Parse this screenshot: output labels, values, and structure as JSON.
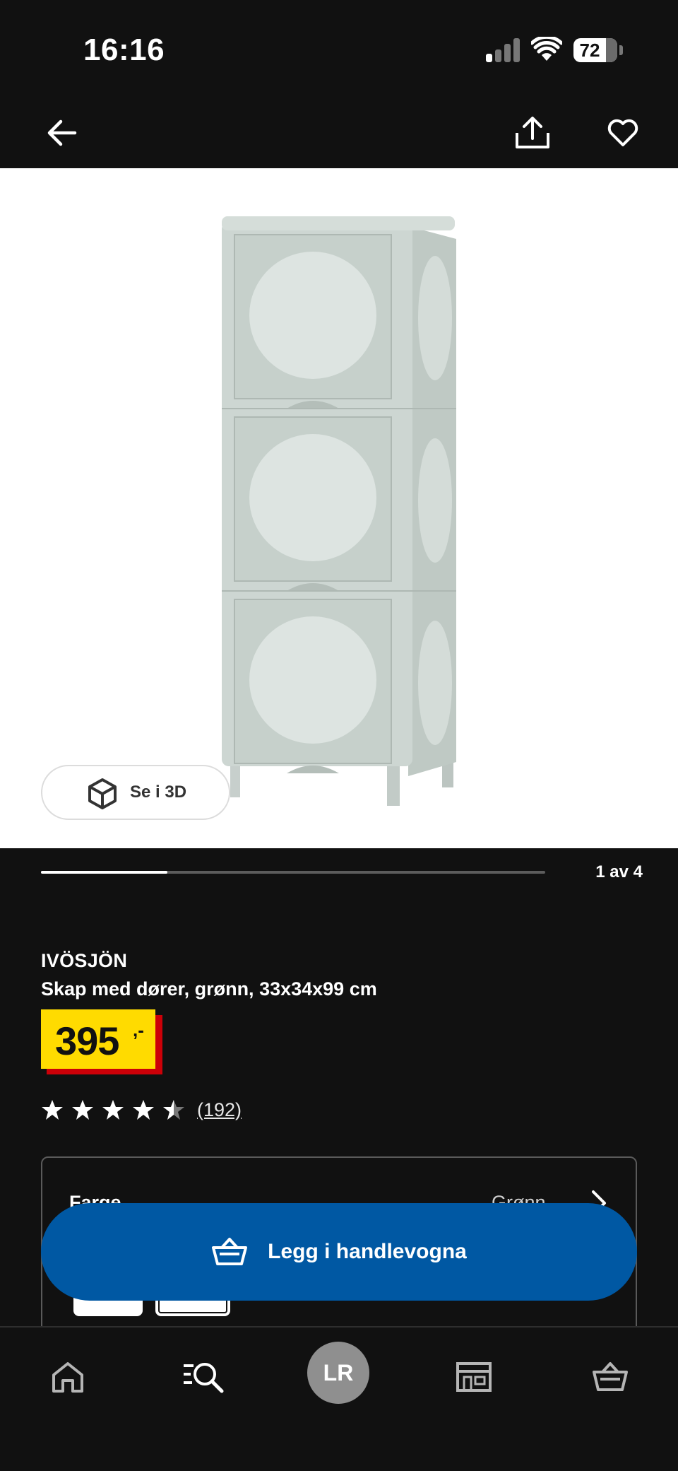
{
  "status_bar": {
    "time": "16:16",
    "battery": "72"
  },
  "top_nav": {
    "back_icon": "arrow-left-icon",
    "share_icon": "share-icon",
    "favourite_icon": "heart-icon"
  },
  "gallery": {
    "view_3d_label": "Se i 3D",
    "pager_text": "1 av 4",
    "current": 1,
    "total": 4
  },
  "product": {
    "brand": "IVÖSJÖN",
    "description": "Skap med dører, grønn, 33x34x99 cm",
    "price": "395",
    "price_suffix": ",-",
    "rating": 4.5,
    "review_count": "(192)"
  },
  "options": {
    "color_label": "Farge",
    "color_value": "Grønn"
  },
  "cart_button": {
    "label": "Legg i handlevogna",
    "color": "#0058a3"
  },
  "bottom_nav": {
    "profile_initials": "LR",
    "items": [
      "home-icon",
      "search-icon",
      "profile-avatar",
      "store-icon",
      "cart-icon"
    ]
  },
  "colors": {
    "background": "#111111",
    "price_yellow": "#ffdb00",
    "price_red": "#cc0008",
    "product_green": "#c9d3cf"
  }
}
